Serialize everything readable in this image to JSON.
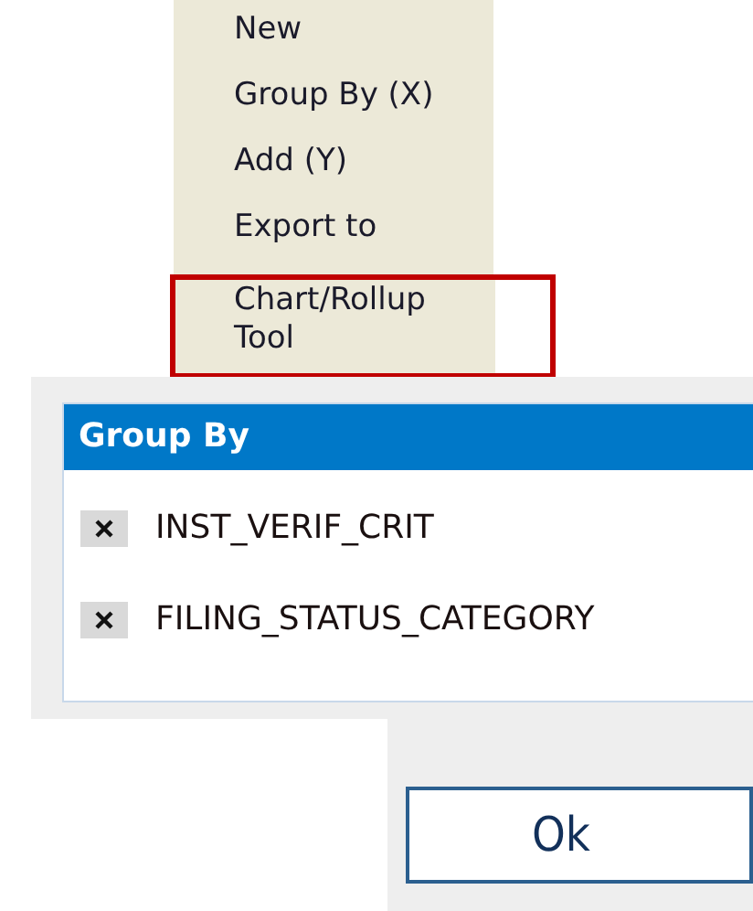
{
  "context_menu": {
    "items": [
      {
        "label": "New",
        "highlighted": false
      },
      {
        "label": "Group By (X)",
        "highlighted": false
      },
      {
        "label": "Add (Y)",
        "highlighted": false
      },
      {
        "label": "Export to",
        "highlighted": false
      },
      {
        "label": "Chart/Rollup Tool",
        "highlighted": true
      }
    ]
  },
  "group_by_panel": {
    "title": "Group By",
    "fields": [
      {
        "label": "INST_VERIF_CRIT"
      },
      {
        "label": "FILING_STATUS_CATEGORY"
      }
    ]
  },
  "buttons": [
    {
      "label": "Ok"
    }
  ]
}
